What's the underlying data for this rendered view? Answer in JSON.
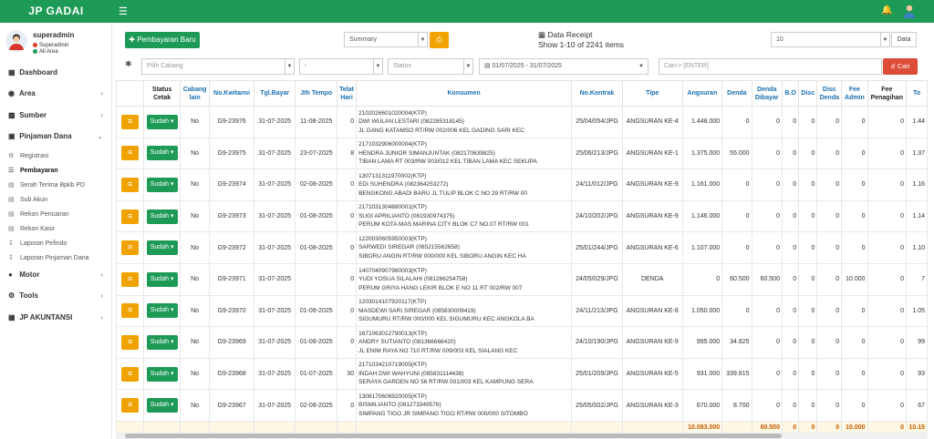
{
  "app": {
    "title": "JP GADAI"
  },
  "user": {
    "name": "superadmin",
    "role": "Superadmin",
    "area": "All Area"
  },
  "sidebar": {
    "items": [
      {
        "label": "Dashboard"
      },
      {
        "label": "Area"
      },
      {
        "label": "Sumber"
      },
      {
        "label": "Pinjaman Dana"
      },
      {
        "label": "Motor"
      },
      {
        "label": "Tools"
      },
      {
        "label": "JP AKUNTANSI"
      }
    ],
    "sub": [
      {
        "label": "Registrasi"
      },
      {
        "label": "Pembayaran"
      },
      {
        "label": "Serah Terima Bpkb PD"
      },
      {
        "label": "Sub Akun"
      },
      {
        "label": "Rekon Pencairan"
      },
      {
        "label": "Rekon Kasir"
      },
      {
        "label": "Laporan Pefindo"
      },
      {
        "label": "Laporan Pinjaman Dana"
      }
    ]
  },
  "toolbar": {
    "new_button": "Pembayaran Baru",
    "view_select": "Summary",
    "info_title": "Data Receipt",
    "info_count": "Show 1-10 of 2241 items",
    "page_size": "10",
    "data_button": "Data"
  },
  "filters": {
    "cabang_placeholder": "Pilih Cabang",
    "dash": "-",
    "status_placeholder": "Status",
    "date_range": "01/07/2025 - 31/07/2025",
    "search_placeholder": "Cari-> [ENTER]",
    "search_button": "Cari"
  },
  "table": {
    "headers": [
      "",
      "Status Cetak",
      "Cabang lain",
      "No.Kwitansi",
      "Tgl.Bayar",
      "Jth Tempo",
      "Telat Hari",
      "Konsumen",
      "No.Kontrak",
      "Tipe",
      "Angsuran",
      "Denda",
      "Denda Dibayar",
      "B.O",
      "Disc",
      "Disc Denda",
      "Fee Admin",
      "Fee Penagihan",
      "To"
    ],
    "status_label": "Sudah",
    "rows": [
      {
        "cabang": "No",
        "kwitansi": "G9-23976",
        "tgl": "31-07-2025",
        "jth": "11-08-2025",
        "telat": "0",
        "k1": "2102026601020004(KTP)",
        "k2": "DWI WULAN LESTARI (082285318145)",
        "k3": "JL GANG KATAMSO RT/RW 002/006 KEL GADING SARI KEC",
        "kontrak": "25/04/054/JPG",
        "tipe": "ANGSURAN KE-4",
        "angsuran": "1.448.000",
        "denda": "0",
        "dendab": "0",
        "bo": "0",
        "disc": "0",
        "discd": "0",
        "feea": "0",
        "feep": "0",
        "to": "1.44"
      },
      {
        "cabang": "No",
        "kwitansi": "G9-23975",
        "tgl": "31-07-2025",
        "jth": "23-07-2025",
        "telat": "8",
        "k1": "2171032906000004(KTP)",
        "k2": "HENDRA JUNIOR SIMANJUNTAK (082170639825)",
        "k3": "TIBAN LAMA RT 003/RW 003/012 KEL TIBAN LAMA KEC SEKUPA",
        "kontrak": "25/06/213/JPG",
        "tipe": "ANGSURAN KE-1",
        "angsuran": "1.375.000",
        "denda": "55.000",
        "dendab": "0",
        "bo": "0",
        "disc": "0",
        "discd": "0",
        "feea": "0",
        "feep": "0",
        "to": "1.37"
      },
      {
        "cabang": "No",
        "kwitansi": "G9-23974",
        "tgl": "31-07-2025",
        "jth": "02-08-2025",
        "telat": "0",
        "k1": "1307131311970002(KTP)",
        "k2": "EDI SUHENDRA (082364253272)",
        "k3": "BENGKONG ABADI BARU JL TULIP BLOK C NO 29 RT/RW 00",
        "kontrak": "24/11/012/JPG",
        "tipe": "ANGSURAN KE-9",
        "angsuran": "1.161.000",
        "denda": "0",
        "dendab": "0",
        "bo": "0",
        "disc": "0",
        "discd": "0",
        "feea": "0",
        "feep": "0",
        "to": "1.16"
      },
      {
        "cabang": "No",
        "kwitansi": "G9-23973",
        "tgl": "31-07-2025",
        "jth": "01-08-2025",
        "telat": "0",
        "k1": "2171031304880001(KTP)",
        "k2": "SUGI APRILIANTO (081930974375)",
        "k3": "PERUM KOTA MAS MARINA CITY BLOK C7 NO.07 RT/RW 001",
        "kontrak": "24/10/202/JPG",
        "tipe": "ANGSURAN KE-9",
        "angsuran": "1.146.000",
        "denda": "0",
        "dendab": "0",
        "bo": "0",
        "disc": "0",
        "discd": "0",
        "feea": "0",
        "feep": "0",
        "to": "1.14"
      },
      {
        "cabang": "No",
        "kwitansi": "G9-23972",
        "tgl": "31-07-2025",
        "jth": "01-08-2025",
        "telat": "0",
        "k1": "1220030605950003(KTP)",
        "k2": "SARWEDI SIREGAR (085215562658)",
        "k3": "SIBORU ANGIN RT/RW 000/000 KEL SIBORU ANGIN KEC HA",
        "kontrak": "25/01/244/JPG",
        "tipe": "ANGSURAN KE-6",
        "angsuran": "1.107.000",
        "denda": "0",
        "dendab": "0",
        "bo": "0",
        "disc": "0",
        "discd": "0",
        "feea": "0",
        "feep": "0",
        "to": "1.10"
      },
      {
        "cabang": "No",
        "kwitansi": "G9-23971",
        "tgl": "31-07-2025",
        "jth": "",
        "telat": "0",
        "k1": "1407040907980003(KTP)",
        "k2": "YUDI YOSUA SILALAHI (081266254758)",
        "k3": "PERUM GRIYA HANG LEKIR BLOK E NO 11 RT 002/RW 007",
        "kontrak": "24/05/029/JPG",
        "tipe": "DENDA",
        "angsuran": "0",
        "denda": "60.500",
        "dendab": "60.500",
        "bo": "0",
        "disc": "0",
        "discd": "0",
        "feea": "10.000",
        "feep": "0",
        "to": "7"
      },
      {
        "cabang": "No",
        "kwitansi": "G9-23970",
        "tgl": "31-07-2025",
        "jth": "01-08-2025",
        "telat": "0",
        "k1": "1203014107920117(KTP)",
        "k2": "MASDEWI SARI SIREGAR (085830009419)",
        "k3": "SIGUMURU RT/RW 000/000 KEL SIGUMURU KEC ANGKOLA BA",
        "kontrak": "24/11/213/JPG",
        "tipe": "ANGSURAN KE-8",
        "angsuran": "1.050.000",
        "denda": "0",
        "dendab": "0",
        "bo": "0",
        "disc": "0",
        "discd": "0",
        "feea": "0",
        "feep": "0",
        "to": "1.05"
      },
      {
        "cabang": "No",
        "kwitansi": "G9-23969",
        "tgl": "31-07-2025",
        "jth": "01-08-2025",
        "telat": "0",
        "k1": "1671063012790013(KTP)",
        "k2": "ANDRY SUTIANTO (081366666420)",
        "k3": "JL ENIM RAYA NO 710 RT/RW 009/003 KEL SIALANG KEC",
        "kontrak": "24/10/190/JPG",
        "tipe": "ANGSURAN KE-9",
        "angsuran": "995.000",
        "denda": "34.825",
        "dendab": "0",
        "bo": "0",
        "disc": "0",
        "discd": "0",
        "feea": "0",
        "feep": "0",
        "to": "99"
      },
      {
        "cabang": "No",
        "kwitansi": "G9-23968",
        "tgl": "31-07-2025",
        "jth": "01-07-2025",
        "telat": "30",
        "k1": "2171034210719005(KTP)",
        "k2": "INDAH DWI WAHYUNI (085831114438)",
        "k3": "SERAYA GARDEN NO 56 RT/RW 001/003 KEL KAMPUNG SERA",
        "kontrak": "25/01/209/JPG",
        "tipe": "ANGSURAN KE-5",
        "angsuran": "931.000",
        "denda": "339.815",
        "dendab": "0",
        "bo": "0",
        "disc": "0",
        "discd": "0",
        "feea": "0",
        "feep": "0",
        "to": "93"
      },
      {
        "cabang": "No",
        "kwitansi": "G9-23967",
        "tgl": "31-07-2025",
        "jth": "02-08-2025",
        "telat": "0",
        "k1": "1308170606920005(KTP)",
        "k2": "BISMILIANTO (081273349576)",
        "k3": "SIMPANG TIGO JR SIMPANG TIGO RT/RW 000/000 SITOMBO",
        "kontrak": "25/05/002/JPG",
        "tipe": "ANGSURAN KE-3",
        "angsuran": "670.000",
        "denda": "8.700",
        "dendab": "0",
        "bo": "0",
        "disc": "0",
        "discd": "0",
        "feea": "0",
        "feep": "0",
        "to": "67"
      }
    ],
    "totals": {
      "angsuran": "10.083.000",
      "dendab": "60.500",
      "bo": "0",
      "disc": "0",
      "discd": "0",
      "feea": "10.000",
      "feep": "0",
      "to": "10.15"
    }
  }
}
